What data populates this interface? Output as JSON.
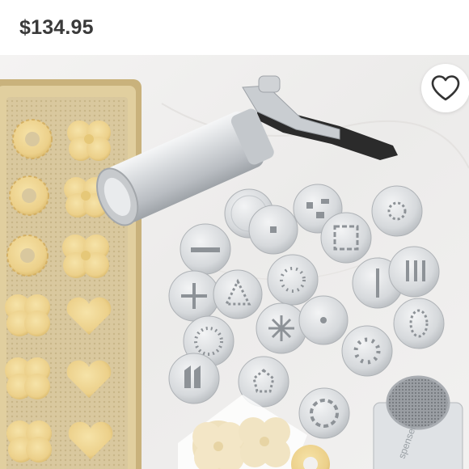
{
  "listing": {
    "price": "$134.95"
  },
  "actions": {
    "like_icon": "heart-outline-icon"
  },
  "colors": {
    "price_text": "#3a3a3a",
    "counter_bg": "#f2f1f0",
    "tray_gold": "#d6c49a",
    "aluminum": "#d7dadd"
  }
}
